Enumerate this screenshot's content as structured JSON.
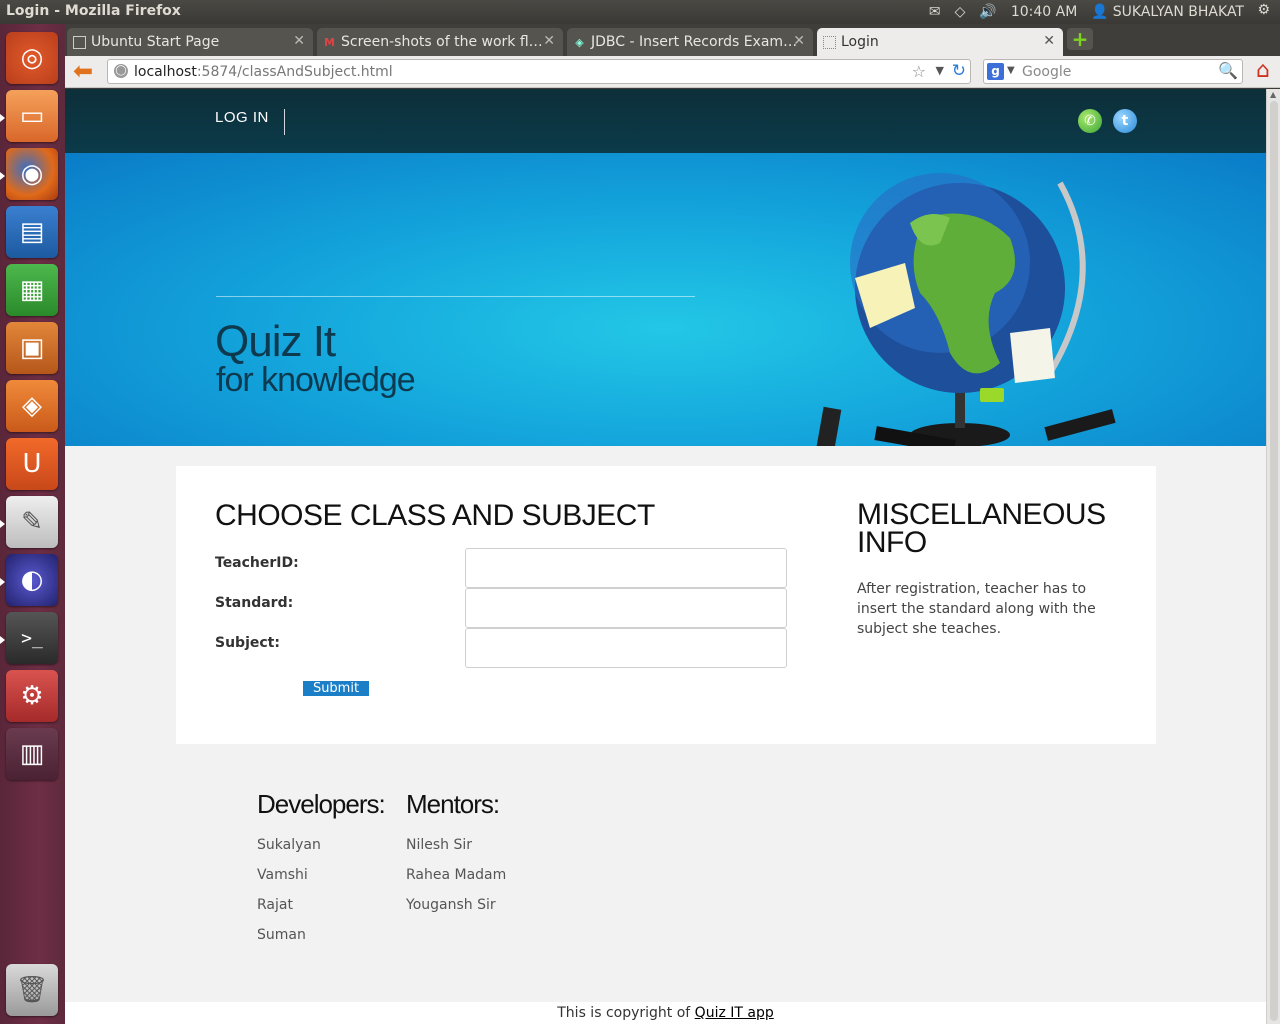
{
  "window": {
    "title": "Login - Mozilla Firefox"
  },
  "tray": {
    "time": "10:40 AM",
    "user": "SUKALYAN BHAKAT"
  },
  "tabs": [
    {
      "label": "Ubuntu Start Page"
    },
    {
      "label": "Screen-shots of the work fl…"
    },
    {
      "label": "JDBC - Insert Records Exam…"
    },
    {
      "label": "Login"
    }
  ],
  "navbar": {
    "url_host": "localhost",
    "url_path": ":5874/classAndSubject.html",
    "search_placeholder": "Google"
  },
  "site": {
    "nav_login": "LOG IN",
    "brand_title": "Quiz It",
    "brand_tagline": "for knowledge"
  },
  "form": {
    "title": "CHOOSE CLASS AND SUBJECT",
    "teacher_label": "TeacherID:",
    "standard_label": "Standard:",
    "subject_label": "Subject:",
    "teacher_value": "",
    "standard_value": "",
    "subject_value": "",
    "submit_label": "Submit"
  },
  "misc": {
    "title": "MISCELLANEOUS INFO",
    "text": "After registration, teacher has to insert the standard along with the subject she teaches."
  },
  "footer": {
    "developers_heading": "Developers:",
    "developers": [
      "Sukalyan",
      "Vamshi",
      "Rajat",
      "Suman"
    ],
    "mentors_heading": "Mentors:",
    "mentors": [
      "Nilesh Sir",
      "Rahea Madam",
      "Yougansh Sir"
    ],
    "copyright_prefix": "This is copyright of ",
    "copyright_link": "Quiz IT app"
  },
  "icons": {
    "launcher": [
      "ubuntu-dash-icon",
      "files-icon",
      "firefox-icon",
      "writer-icon",
      "calc-icon",
      "impress-icon",
      "software-center-icon",
      "ubuntu-one-icon",
      "text-editor-icon",
      "eclipse-icon",
      "terminal-icon",
      "system-settings-icon",
      "workspace-switcher-icon",
      "trash-icon"
    ]
  },
  "colors": {
    "site_nav": "#0b3a49",
    "banner": "#14a6dc",
    "submit": "#1a7fc6"
  }
}
